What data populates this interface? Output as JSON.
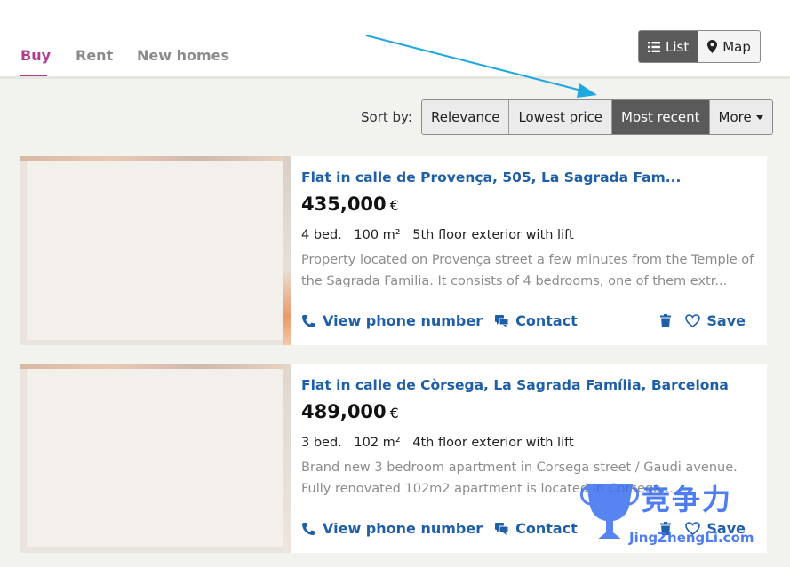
{
  "tabs": [
    {
      "label": "Buy"
    },
    {
      "label": "Rent"
    },
    {
      "label": "New homes"
    }
  ],
  "view_toggle": {
    "list_label": "List",
    "map_label": "Map"
  },
  "sort": {
    "label": "Sort by:",
    "options": [
      "Relevance",
      "Lowest price",
      "Most recent",
      "More"
    ],
    "selected": "Most recent"
  },
  "listings": [
    {
      "title": "Flat in calle de Provença, 505, La Sagrada Fam...",
      "price": "435,000",
      "currency": "€",
      "bedrooms": "4 bed.",
      "area": "100 m²",
      "floor": "5th floor exterior with lift",
      "description": "Property located on Provença street a few minutes from the Temple of the Sagrada Familia. It consists of 4 bedrooms, one of them extr...",
      "phone_label": "View phone number",
      "contact_label": "Contact",
      "save_label": "Save"
    },
    {
      "title": "Flat in calle de Còrsega, La Sagrada Família, Barcelona",
      "price": "489,000",
      "currency": "€",
      "bedrooms": "3 bed.",
      "area": "102 m²",
      "floor": "4th floor exterior with lift",
      "description": "Brand new 3 bedroom apartment in Corsega street / Gaudi avenue. Fully renovated 102m2 apartment is located in Corsega...",
      "phone_label": "View phone number",
      "contact_label": "Contact",
      "save_label": "Save"
    }
  ],
  "watermark": {
    "text": "竞争力",
    "sub": "JingZhengLi.com"
  },
  "colors": {
    "accent": "#b13b8c",
    "link": "#1f5fa8",
    "arrow": "#1fa8e0"
  }
}
